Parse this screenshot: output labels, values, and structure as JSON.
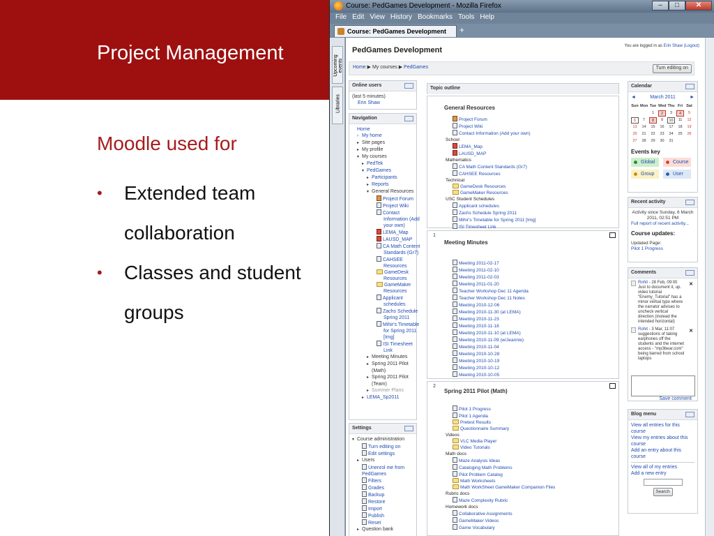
{
  "slide": {
    "title": "Project Management",
    "subtitle": "Moodle used for",
    "bullets": [
      "Extended team collaboration",
      "Classes and student groups"
    ]
  },
  "browser": {
    "window_title": "Course: PedGames Development - Mozilla Firefox",
    "menu": [
      "File",
      "Edit",
      "View",
      "History",
      "Bookmarks",
      "Tools",
      "Help"
    ],
    "tab_label": "Course: PedGames Development",
    "new_tab": "+",
    "side_tabs": [
      "Upcoming events",
      "Libraries"
    ]
  },
  "page": {
    "course_title": "PedGames Development",
    "login_prefix": "You are logged in as",
    "login_user": "Erin Shaw",
    "logout": "(Logout)",
    "breadcrumb": [
      "Home",
      "My courses",
      "PedGames"
    ],
    "edit_button": "Turn editing on"
  },
  "online_users": {
    "title": "Online users",
    "period": "(last 5 minutes)",
    "user": "Erin Shaw"
  },
  "navigation": {
    "title": "Navigation",
    "items": [
      {
        "label": "Home",
        "indent": 0,
        "arrow": "",
        "link": true
      },
      {
        "label": "My home",
        "indent": 1,
        "arrow": "›",
        "link": true
      },
      {
        "label": "Site pages",
        "indent": 1,
        "arrow": "▸",
        "link": false
      },
      {
        "label": "My profile",
        "indent": 1,
        "arrow": "▸",
        "link": false
      },
      {
        "label": "My courses",
        "indent": 1,
        "arrow": "▾",
        "link": false
      },
      {
        "label": "PedTek",
        "indent": 2,
        "arrow": "▸",
        "link": true
      },
      {
        "label": "PedGames",
        "indent": 2,
        "arrow": "▾",
        "link": true
      },
      {
        "label": "Participants",
        "indent": 3,
        "arrow": "▸",
        "link": true
      },
      {
        "label": "Reports",
        "indent": 3,
        "arrow": "▸",
        "link": true
      },
      {
        "label": "General Resources",
        "indent": 3,
        "arrow": "▾",
        "link": false
      },
      {
        "label": "Project Forum",
        "indent": 4,
        "arrow": "",
        "link": true,
        "icon": "forum"
      },
      {
        "label": "Project Wiki",
        "indent": 4,
        "arrow": "",
        "link": true,
        "icon": "doc"
      },
      {
        "label": "Contact",
        "indent": 4,
        "arrow": "",
        "link": true,
        "icon": "doc"
      },
      {
        "label": "Information (Add",
        "indent": 4,
        "arrow": "",
        "link": true,
        "icon": ""
      },
      {
        "label": "your own)",
        "indent": 4,
        "arrow": "",
        "link": true,
        "icon": ""
      },
      {
        "label": "LEMA_Map",
        "indent": 4,
        "arrow": "",
        "link": true,
        "icon": "pdf"
      },
      {
        "label": "LAUSD_MAP",
        "indent": 4,
        "arrow": "",
        "link": true,
        "icon": "pdf"
      },
      {
        "label": "CA Math Content",
        "indent": 4,
        "arrow": "",
        "link": true,
        "icon": "doc"
      },
      {
        "label": "Standards (Gr7)",
        "indent": 4,
        "arrow": "",
        "link": true,
        "icon": ""
      },
      {
        "label": "CAHSEE",
        "indent": 4,
        "arrow": "",
        "link": true,
        "icon": "doc"
      },
      {
        "label": "Resources",
        "indent": 4,
        "arrow": "",
        "link": true,
        "icon": ""
      },
      {
        "label": "GameDesk",
        "indent": 4,
        "arrow": "",
        "link": true,
        "icon": "folder"
      },
      {
        "label": "Resources",
        "indent": 4,
        "arrow": "",
        "link": true,
        "icon": ""
      },
      {
        "label": "GameMaker",
        "indent": 4,
        "arrow": "",
        "link": true,
        "icon": "folder"
      },
      {
        "label": "Resources",
        "indent": 4,
        "arrow": "",
        "link": true,
        "icon": ""
      },
      {
        "label": "Applicant",
        "indent": 4,
        "arrow": "",
        "link": true,
        "icon": "doc"
      },
      {
        "label": "schedules",
        "indent": 4,
        "arrow": "",
        "link": true,
        "icon": ""
      },
      {
        "label": "Zachs Schedule",
        "indent": 4,
        "arrow": "",
        "link": true,
        "icon": "doc"
      },
      {
        "label": "Spring 2011",
        "indent": 4,
        "arrow": "",
        "link": true,
        "icon": ""
      },
      {
        "label": "Mihir's Timetable",
        "indent": 4,
        "arrow": "",
        "link": true,
        "icon": "doc"
      },
      {
        "label": "for Spring 2011",
        "indent": 4,
        "arrow": "",
        "link": true,
        "icon": ""
      },
      {
        "label": "[Img]",
        "indent": 4,
        "arrow": "",
        "link": true,
        "icon": ""
      },
      {
        "label": "ISI Timesheet",
        "indent": 4,
        "arrow": "",
        "link": true,
        "icon": "doc"
      },
      {
        "label": "Link",
        "indent": 4,
        "arrow": "",
        "link": true,
        "icon": ""
      },
      {
        "label": "Meeting Minutes",
        "indent": 3,
        "arrow": "▸",
        "link": false
      },
      {
        "label": "Spring 2011 Pilot",
        "indent": 3,
        "arrow": "▸",
        "link": false
      },
      {
        "label": "(Math)",
        "indent": 3,
        "arrow": "",
        "link": false
      },
      {
        "label": "Spring 2011 Pilot",
        "indent": 3,
        "arrow": "▸",
        "link": false
      },
      {
        "label": "(Team)",
        "indent": 3,
        "arrow": "",
        "link": false
      },
      {
        "label": "Summer Plans",
        "indent": 3,
        "arrow": "▸",
        "link": false
      },
      {
        "label": "LEMA_Sp2011",
        "indent": 2,
        "arrow": "▸",
        "link": true
      }
    ]
  },
  "settings": {
    "title": "Settings",
    "items": [
      {
        "label": "Course administration",
        "indent": 0,
        "arrow": "▾",
        "link": false
      },
      {
        "label": "Turn editing on",
        "indent": 1,
        "arrow": "",
        "link": true,
        "icon": "doc"
      },
      {
        "label": "Edit settings",
        "indent": 1,
        "arrow": "",
        "link": true,
        "icon": "doc"
      },
      {
        "label": "Users",
        "indent": 1,
        "arrow": "▸",
        "link": false
      },
      {
        "label": "Unenrol me from",
        "indent": 1,
        "arrow": "",
        "link": true,
        "icon": "doc"
      },
      {
        "label": "PedGames",
        "indent": 1,
        "arrow": "",
        "link": true,
        "icon": ""
      },
      {
        "label": "Filters",
        "indent": 1,
        "arrow": "",
        "link": true,
        "icon": "doc"
      },
      {
        "label": "Grades",
        "indent": 1,
        "arrow": "",
        "link": true,
        "icon": "doc"
      },
      {
        "label": "Backup",
        "indent": 1,
        "arrow": "",
        "link": true,
        "icon": "doc"
      },
      {
        "label": "Restore",
        "indent": 1,
        "arrow": "",
        "link": true,
        "icon": "doc"
      },
      {
        "label": "Import",
        "indent": 1,
        "arrow": "",
        "link": true,
        "icon": "doc"
      },
      {
        "label": "Publish",
        "indent": 1,
        "arrow": "",
        "link": true,
        "icon": "doc"
      },
      {
        "label": "Reset",
        "indent": 1,
        "arrow": "",
        "link": true,
        "icon": "doc"
      },
      {
        "label": "Question bank",
        "indent": 1,
        "arrow": "▸",
        "link": false
      }
    ]
  },
  "topic_outline": {
    "title": "Topic outline",
    "general": {
      "title": "General Resources",
      "items": [
        {
          "label": "Project Forum",
          "type": "link",
          "icon": "forum"
        },
        {
          "label": "Project Wiki",
          "type": "link",
          "icon": "doc"
        },
        {
          "label": "Contact Information (Add your own)",
          "type": "link",
          "icon": "doc"
        },
        {
          "label": "School",
          "type": "head",
          "icon": ""
        },
        {
          "label": "LEMA_Map",
          "type": "link",
          "icon": "pdf"
        },
        {
          "label": "LAUSD_MAP",
          "type": "link",
          "icon": "pdf"
        },
        {
          "label": "Mathematics",
          "type": "head",
          "icon": ""
        },
        {
          "label": "CA Math Content Standards (Gr7)",
          "type": "link",
          "icon": "doc"
        },
        {
          "label": "CAHSEE Resources",
          "type": "link",
          "icon": "doc"
        },
        {
          "label": "Technical",
          "type": "head",
          "icon": ""
        },
        {
          "label": "GameDesk Resources",
          "type": "link",
          "icon": "folder"
        },
        {
          "label": "GameMaker Resources",
          "type": "link",
          "icon": "folder"
        },
        {
          "label": "USC Student Schedules",
          "type": "head",
          "icon": ""
        },
        {
          "label": "Applicant schedules",
          "type": "link",
          "icon": "doc"
        },
        {
          "label": "Zachs Schedule Spring 2011",
          "type": "link",
          "icon": "doc"
        },
        {
          "label": "Mihir's Timetable for Spring 2011 [Img]",
          "type": "link",
          "icon": "doc"
        },
        {
          "label": "ISI Timesheet Link",
          "type": "link",
          "icon": "doc"
        }
      ]
    },
    "topic1": {
      "number": "1",
      "title": "Meeting Minutes",
      "items": [
        "Meeting 2011-02-17",
        "Meeting 2011-02-10",
        "Meeting 2011-02-03",
        "Meeting 2011-01-20",
        "Teacher Workshop Dec 11 Agenda",
        "Teacher Workshop Dec 11 Notes",
        "Meeting 2010-12-06",
        "Meeting 2010-11-30 (at LEMA)",
        "Meeting 2010-11-23",
        "Meeting 2010-11-18",
        "Meeting 2010-11-10 (at LEMA)",
        "Meeting 2010-11-09 (w/Jeannie)",
        "Meeting 2010-11-04",
        "Meeting 2010-10-28",
        "Meeting 2010-10-19",
        "Meeting 2010-10-12",
        "Meeting 2010-10-05"
      ]
    },
    "topic2": {
      "number": "2",
      "title": "Spring 2011 Pilot (Math)",
      "items": [
        {
          "label": "Pilot 1 Progress",
          "type": "link",
          "icon": "doc"
        },
        {
          "label": "Pilot 1 Agenda",
          "type": "link",
          "icon": "doc"
        },
        {
          "label": "Pretest Results",
          "type": "link",
          "icon": "folder"
        },
        {
          "label": "Questionnaire Summary",
          "type": "link",
          "icon": "folder"
        },
        {
          "label": "Videos",
          "type": "head",
          "icon": ""
        },
        {
          "label": "VLC Media Player",
          "type": "link",
          "icon": "folder"
        },
        {
          "label": "Video Tutorials",
          "type": "link",
          "icon": "folder"
        },
        {
          "label": "Math docs",
          "type": "head",
          "icon": ""
        },
        {
          "label": "Maze Analysis Ideas",
          "type": "link",
          "icon": "doc"
        },
        {
          "label": "Cataloging Math Problems",
          "type": "link",
          "icon": "doc"
        },
        {
          "label": "Pilot Problem Catalog",
          "type": "link",
          "icon": "doc"
        },
        {
          "label": "Math Worksheets",
          "type": "link",
          "icon": "folder"
        },
        {
          "label": "Math WorkSheet GameMaker Companion Files",
          "type": "link",
          "icon": "folder"
        },
        {
          "label": "Rubric docs",
          "type": "head",
          "icon": ""
        },
        {
          "label": "Maze Complexity Rubric",
          "type": "link",
          "icon": "doc"
        },
        {
          "label": "Homework docs",
          "type": "head",
          "icon": ""
        },
        {
          "label": "Collaborative Assignments",
          "type": "link",
          "icon": "doc"
        },
        {
          "label": "GameMaker Videos",
          "type": "link",
          "icon": "doc"
        },
        {
          "label": "Game Vocabulary",
          "type": "link",
          "icon": "doc"
        }
      ]
    }
  },
  "calendar": {
    "title": "Calendar",
    "prev": "◄",
    "next": "►",
    "month": "March 2011",
    "weekdays": [
      "Sun",
      "Mon",
      "Tue",
      "Wed",
      "Thu",
      "Fri",
      "Sat"
    ],
    "leading_blanks": 2,
    "days": 31,
    "boxed": [
      6,
      10
    ],
    "highlighted": [
      2,
      4,
      8
    ],
    "events_key_title": "Events key",
    "events_key": [
      {
        "label": "Global",
        "color": "#cdeecb",
        "dot": "#1e8d33"
      },
      {
        "label": "Course",
        "color": "#fcdcd6",
        "dot": "#d3432d"
      },
      {
        "label": "Group",
        "color": "#fbf1c2",
        "dot": "#c08d12"
      },
      {
        "label": "User",
        "color": "#dce8f6",
        "dot": "#2a5ba8"
      }
    ]
  },
  "recent_activity": {
    "title": "Recent activity",
    "since_line1": "Activity since Sunday, 6 March",
    "since_line2": "2011, 02:51 PM",
    "full_report": "Full report of recent activity...",
    "updates_title": "Course updates:",
    "updated_label": "Updated Page:",
    "updated_link": "Pilot 1 Progress"
  },
  "comments": {
    "title": "Comments",
    "entries": [
      {
        "author": "Rohit",
        "lines": [
          "- 28 Feb, 09:00",
          "Just to document it, up.",
          "video tutorial",
          "\"Enemy_Tutorial\" has a",
          "minor verbal typo where",
          "the narrator advises to",
          "uncheck vertical",
          "direction (instead the",
          "intended horizontal)"
        ]
      },
      {
        "author": "Rohit",
        "lines": [
          "- 3 Mar, 11:07",
          "suggestions of taking",
          "earphones off the",
          "students and the internet",
          "access - \"mp3bear.com\"",
          "being barred from school",
          "laptops"
        ]
      }
    ],
    "save": "Save comment",
    "delete_glyph": "✕"
  },
  "blog_menu": {
    "title": "Blog menu",
    "links": [
      "View all entries for this",
      "course",
      "View my entries about this",
      "course",
      "Add an entry about this",
      "course"
    ],
    "links2": [
      "View all of my entries",
      "Add a new entry"
    ],
    "search": "Search"
  }
}
